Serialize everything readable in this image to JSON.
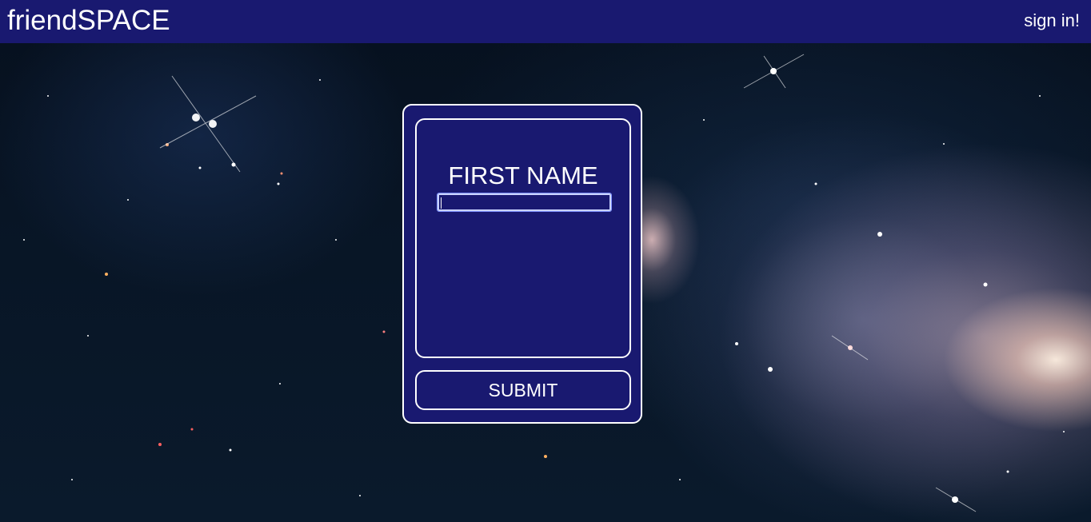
{
  "app": {
    "brand": "friendSPACE"
  },
  "nav": {
    "signin_label": "sign in!"
  },
  "form": {
    "field_label": "FIRST NAME",
    "field_value": "",
    "submit_label": "SUBMIT"
  },
  "colors": {
    "navbar": "#191970",
    "card": "#191970",
    "text": "#ffffff"
  }
}
